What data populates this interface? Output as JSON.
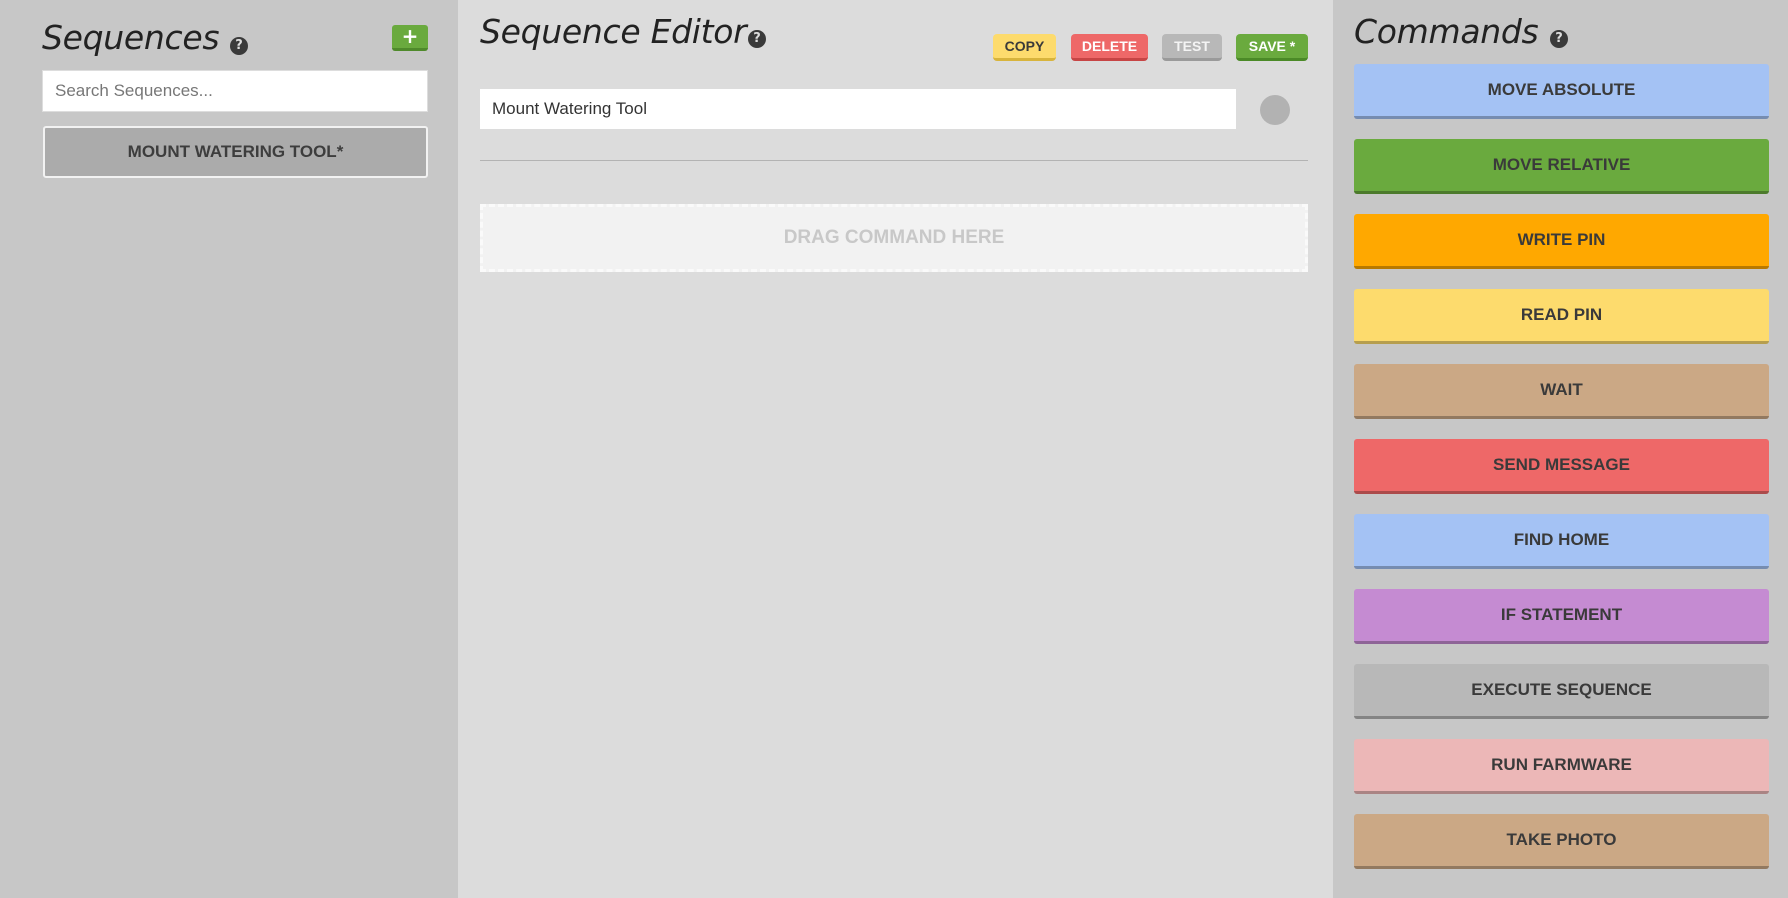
{
  "sequences_panel": {
    "title": "Sequences",
    "help_icon": "question-circle-icon",
    "add_label": "+",
    "search_placeholder": "Search Sequences...",
    "items": [
      {
        "label": "MOUNT WATERING TOOL*"
      }
    ]
  },
  "editor": {
    "title": "Sequence Editor",
    "help_icon": "question-circle-icon",
    "buttons": {
      "copy": "COPY",
      "delete": "DELETE",
      "test": "TEST",
      "save": "SAVE *"
    },
    "sequence_name": "Mount Watering Tool",
    "color_dot": "#b2b2b2",
    "dropzone_label": "DRAG COMMAND HERE"
  },
  "commands_panel": {
    "title": "Commands",
    "help_icon": "question-circle-icon",
    "commands": [
      {
        "label": "MOVE ABSOLUTE",
        "color": "#a4c2f4"
      },
      {
        "label": "MOVE RELATIVE",
        "color": "#6aaa3e"
      },
      {
        "label": "WRITE PIN",
        "color": "#ffa800"
      },
      {
        "label": "READ PIN",
        "color": "#fddb6d"
      },
      {
        "label": "WAIT",
        "color": "#cba885"
      },
      {
        "label": "SEND MESSAGE",
        "color": "#ee6868"
      },
      {
        "label": "FIND HOME",
        "color": "#a4c2f4"
      },
      {
        "label": "IF STATEMENT",
        "color": "#c58bd2"
      },
      {
        "label": "EXECUTE SEQUENCE",
        "color": "#b8b8b8"
      },
      {
        "label": "RUN FARMWARE",
        "color": "#ecb7b7"
      },
      {
        "label": "TAKE PHOTO",
        "color": "#cba885"
      }
    ]
  }
}
